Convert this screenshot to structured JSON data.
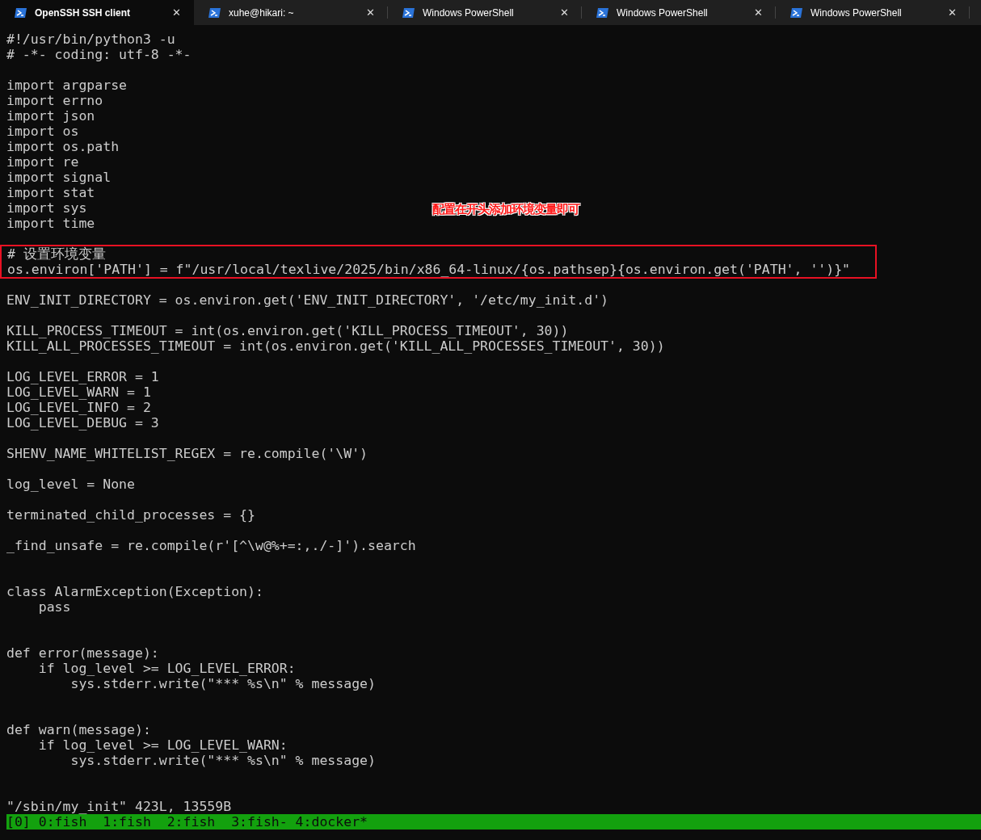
{
  "tabs": [
    {
      "title": "OpenSSH SSH client",
      "selected": true,
      "close": "✕"
    },
    {
      "title": "xuhe@hikari: ~",
      "selected": false,
      "close": "✕"
    },
    {
      "title": "Windows PowerShell",
      "selected": false,
      "close": "✕"
    },
    {
      "title": "Windows PowerShell",
      "selected": false,
      "close": "✕"
    },
    {
      "title": "Windows PowerShell",
      "selected": false,
      "close": "✕"
    }
  ],
  "editor": {
    "blocks": [
      {
        "kind": "code",
        "lines": [
          "#!/usr/bin/python3 -u",
          "# -*- coding: utf-8 -*-"
        ]
      },
      {
        "kind": "blank"
      },
      {
        "kind": "code",
        "lines": [
          "import argparse",
          "import errno",
          "import json",
          "import os",
          "import os.path",
          "import re",
          "import signal",
          "import stat",
          "import sys",
          "import time"
        ]
      },
      {
        "kind": "blank"
      },
      {
        "kind": "highlight",
        "lines": [
          "# 设置环境变量",
          "os.environ['PATH'] = f\"/usr/local/texlive/2025/bin/x86_64-linux/{os.pathsep}{os.environ.get('PATH', '')}\""
        ]
      },
      {
        "kind": "blank"
      },
      {
        "kind": "code",
        "lines": [
          "ENV_INIT_DIRECTORY = os.environ.get('ENV_INIT_DIRECTORY', '/etc/my_init.d')"
        ]
      },
      {
        "kind": "blank"
      },
      {
        "kind": "code",
        "lines": [
          "KILL_PROCESS_TIMEOUT = int(os.environ.get('KILL_PROCESS_TIMEOUT', 30))",
          "KILL_ALL_PROCESSES_TIMEOUT = int(os.environ.get('KILL_ALL_PROCESSES_TIMEOUT', 30))"
        ]
      },
      {
        "kind": "blank"
      },
      {
        "kind": "code",
        "lines": [
          "LOG_LEVEL_ERROR = 1",
          "LOG_LEVEL_WARN = 1",
          "LOG_LEVEL_INFO = 2",
          "LOG_LEVEL_DEBUG = 3"
        ]
      },
      {
        "kind": "blank"
      },
      {
        "kind": "code",
        "lines": [
          "SHENV_NAME_WHITELIST_REGEX = re.compile('\\W')"
        ]
      },
      {
        "kind": "blank"
      },
      {
        "kind": "code",
        "lines": [
          "log_level = None"
        ]
      },
      {
        "kind": "blank"
      },
      {
        "kind": "code",
        "lines": [
          "terminated_child_processes = {}"
        ]
      },
      {
        "kind": "blank"
      },
      {
        "kind": "code",
        "lines": [
          "_find_unsafe = re.compile(r'[^\\w@%+=:,./-]').search"
        ]
      },
      {
        "kind": "blank"
      },
      {
        "kind": "blank"
      },
      {
        "kind": "code",
        "lines": [
          "class AlarmException(Exception):",
          "    pass"
        ]
      },
      {
        "kind": "blank"
      },
      {
        "kind": "blank"
      },
      {
        "kind": "code",
        "lines": [
          "def error(message):",
          "    if log_level >= LOG_LEVEL_ERROR:",
          "        sys.stderr.write(\"*** %s\\n\" % message)"
        ]
      },
      {
        "kind": "blank"
      },
      {
        "kind": "blank"
      },
      {
        "kind": "code",
        "lines": [
          "def warn(message):",
          "    if log_level >= LOG_LEVEL_WARN:",
          "        sys.stderr.write(\"*** %s\\n\" % message)"
        ]
      },
      {
        "kind": "blank"
      },
      {
        "kind": "blank"
      },
      {
        "kind": "code",
        "lines": [
          "\"/sbin/my_init\" 423L, 13559B"
        ]
      }
    ]
  },
  "annotation": "配置在开头添加环境变量即可",
  "tmux_status": "[0] 0:fish  1:fish  2:fish  3:fish- 4:docker*"
}
